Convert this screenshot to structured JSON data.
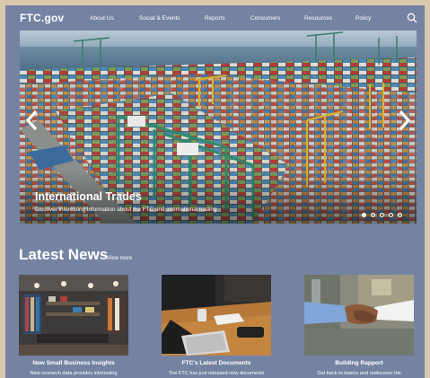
{
  "nav": {
    "logo": "FTC.gov",
    "items": [
      {
        "label": "About Us"
      },
      {
        "label": "Social & Events"
      },
      {
        "label": "Reports"
      },
      {
        "label": "Consumers"
      },
      {
        "label": "Resources"
      },
      {
        "label": "Policy"
      }
    ],
    "search_icon": "search-icon"
  },
  "hero": {
    "title": "International Trades",
    "subtitle": "Discover interesting information about the FTC and international trading",
    "slide_count": 5,
    "active_slide": 1,
    "prev_icon": "chevron-left-icon",
    "next_icon": "chevron-right-icon"
  },
  "news": {
    "heading": "Latest News",
    "view_more": "View more",
    "cards": [
      {
        "title": "New Small Business Insights",
        "desc": "New research data provides interesting"
      },
      {
        "title": "FTC's Latest Documents",
        "desc": "The FTC has just released new documents"
      },
      {
        "title": "Building Rapport",
        "desc": "Get back to basics and rediscover the"
      }
    ]
  },
  "colors": {
    "page_background": "#7583a3",
    "outer_background": "#d9c8ad",
    "text": "#ffffff"
  }
}
